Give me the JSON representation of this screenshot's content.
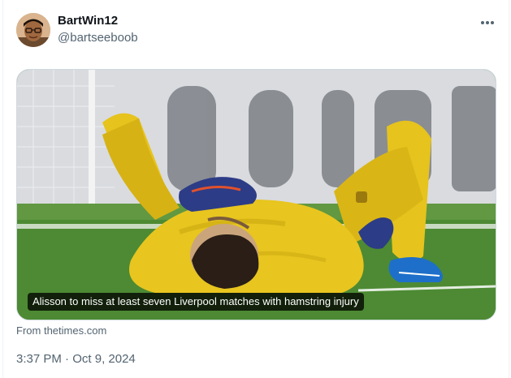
{
  "author": {
    "name": "BartWin12",
    "handle": "@bartseeboob"
  },
  "icons": {
    "more": "more-horizontal-icon",
    "avatar": "profile-avatar"
  },
  "card": {
    "caption": "Alisson to miss at least seven Liverpool matches with hamstring injury",
    "source_prefix": "From",
    "source_domain": "thetimes.com"
  },
  "meta": {
    "time": "3:37 PM",
    "separator": "·",
    "date": "Oct 9, 2024"
  },
  "colors": {
    "text_primary": "#0f1419",
    "text_secondary": "#536471",
    "border": "#cfd9de",
    "kit_yellow": "#e8c51f",
    "pitch_green": "#3f7a2c"
  }
}
